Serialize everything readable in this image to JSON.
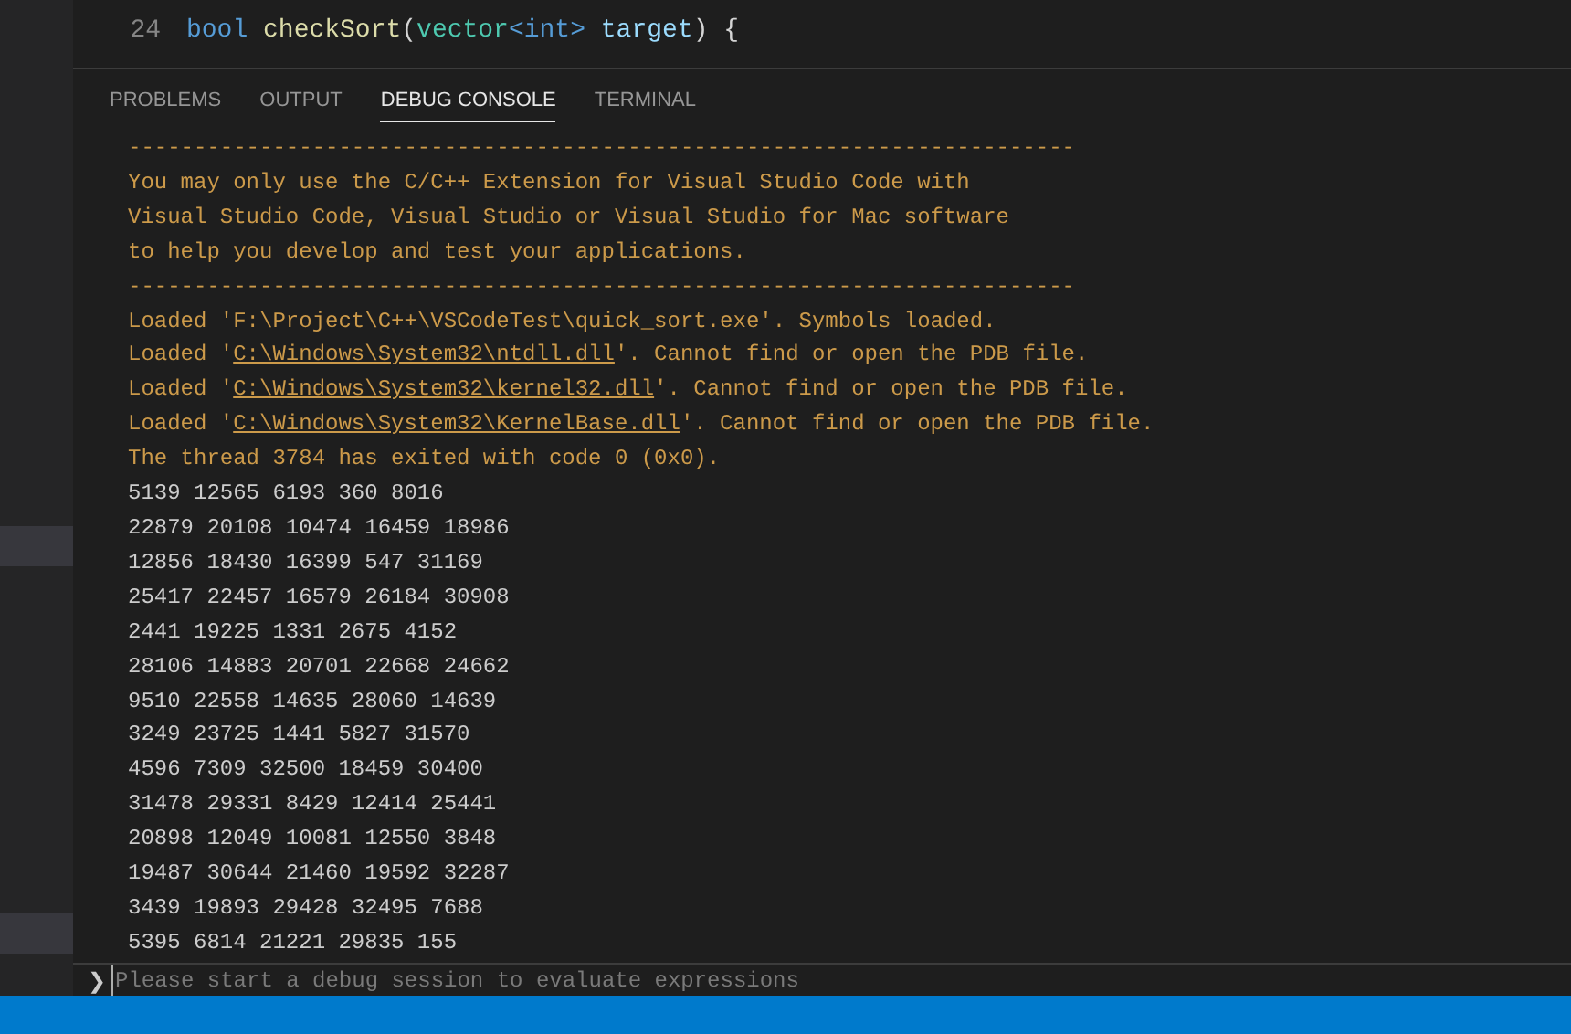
{
  "editor": {
    "lines": [
      {
        "number": "24",
        "tokens": [
          {
            "kind": "keyword",
            "text": "bool "
          },
          {
            "kind": "function",
            "text": "checkSort"
          },
          {
            "kind": "plain",
            "text": "("
          },
          {
            "kind": "type",
            "text": "vector"
          },
          {
            "kind": "keyword",
            "text": "<int> "
          },
          {
            "kind": "variable",
            "text": "target"
          },
          {
            "kind": "plain",
            "text": ") {"
          }
        ]
      }
    ]
  },
  "panel": {
    "tabs": [
      {
        "label": "PROBLEMS",
        "selected": false
      },
      {
        "label": "OUTPUT",
        "selected": false
      },
      {
        "label": "DEBUG CONSOLE",
        "selected": true
      },
      {
        "label": "TERMINAL",
        "selected": false
      }
    ],
    "console": [
      {
        "kind": "warning",
        "segments": [
          {
            "kind": "text",
            "text": "------------------------------------------------------------------------"
          }
        ]
      },
      {
        "kind": "warning",
        "segments": [
          {
            "kind": "text",
            "text": "You may only use the C/C++ Extension for Visual Studio Code with"
          }
        ]
      },
      {
        "kind": "warning",
        "segments": [
          {
            "kind": "text",
            "text": "Visual Studio Code, Visual Studio or Visual Studio for Mac software"
          }
        ]
      },
      {
        "kind": "warning",
        "segments": [
          {
            "kind": "text",
            "text": "to help you develop and test your applications."
          }
        ]
      },
      {
        "kind": "warning",
        "segments": [
          {
            "kind": "text",
            "text": "------------------------------------------------------------------------"
          }
        ]
      },
      {
        "kind": "warning",
        "segments": [
          {
            "kind": "text",
            "text": "Loaded 'F:\\Project\\C++\\VSCodeTest\\quick_sort.exe'. Symbols loaded."
          }
        ]
      },
      {
        "kind": "warning",
        "segments": [
          {
            "kind": "text",
            "text": "Loaded '"
          },
          {
            "kind": "link",
            "text": "C:\\Windows\\System32\\ntdll.dll"
          },
          {
            "kind": "text",
            "text": "'. Cannot find or open the PDB file."
          }
        ]
      },
      {
        "kind": "warning",
        "segments": [
          {
            "kind": "text",
            "text": "Loaded '"
          },
          {
            "kind": "link",
            "text": "C:\\Windows\\System32\\kernel32.dll"
          },
          {
            "kind": "text",
            "text": "'. Cannot find or open the PDB file."
          }
        ]
      },
      {
        "kind": "warning",
        "segments": [
          {
            "kind": "text",
            "text": "Loaded '"
          },
          {
            "kind": "link",
            "text": "C:\\Windows\\System32\\KernelBase.dll"
          },
          {
            "kind": "text",
            "text": "'. Cannot find or open the PDB file."
          }
        ]
      },
      {
        "kind": "warning",
        "segments": [
          {
            "kind": "text",
            "text": "The thread 3784 has exited with code 0 (0x0)."
          }
        ]
      },
      {
        "kind": "output",
        "segments": [
          {
            "kind": "text",
            "text": "5139 12565 6193 360 8016"
          }
        ]
      },
      {
        "kind": "output",
        "segments": [
          {
            "kind": "text",
            "text": "22879 20108 10474 16459 18986"
          }
        ]
      },
      {
        "kind": "output",
        "segments": [
          {
            "kind": "text",
            "text": "12856 18430 16399 547 31169"
          }
        ]
      },
      {
        "kind": "output",
        "segments": [
          {
            "kind": "text",
            "text": "25417 22457 16579 26184 30908"
          }
        ]
      },
      {
        "kind": "output",
        "segments": [
          {
            "kind": "text",
            "text": "2441 19225 1331 2675 4152"
          }
        ]
      },
      {
        "kind": "output",
        "segments": [
          {
            "kind": "text",
            "text": "28106 14883 20701 22668 24662"
          }
        ]
      },
      {
        "kind": "output",
        "segments": [
          {
            "kind": "text",
            "text": "9510 22558 14635 28060 14639"
          }
        ]
      },
      {
        "kind": "output",
        "segments": [
          {
            "kind": "text",
            "text": "3249 23725 1441 5827 31570"
          }
        ]
      },
      {
        "kind": "output",
        "segments": [
          {
            "kind": "text",
            "text": "4596 7309 32500 18459 30400"
          }
        ]
      },
      {
        "kind": "output",
        "segments": [
          {
            "kind": "text",
            "text": "31478 29331 8429 12414 25441"
          }
        ]
      },
      {
        "kind": "output",
        "segments": [
          {
            "kind": "text",
            "text": "20898 12049 10081 12550 3848"
          }
        ]
      },
      {
        "kind": "output",
        "segments": [
          {
            "kind": "text",
            "text": "19487 30644 21460 19592 32287"
          }
        ]
      },
      {
        "kind": "output",
        "segments": [
          {
            "kind": "text",
            "text": "3439 19893 29428 32495 7688"
          }
        ]
      },
      {
        "kind": "output",
        "segments": [
          {
            "kind": "text",
            "text": "5395 6814 21221 29835 155"
          }
        ]
      }
    ],
    "input": {
      "prompt": "❯",
      "placeholder": "Please start a debug session to evaluate expressions"
    }
  }
}
